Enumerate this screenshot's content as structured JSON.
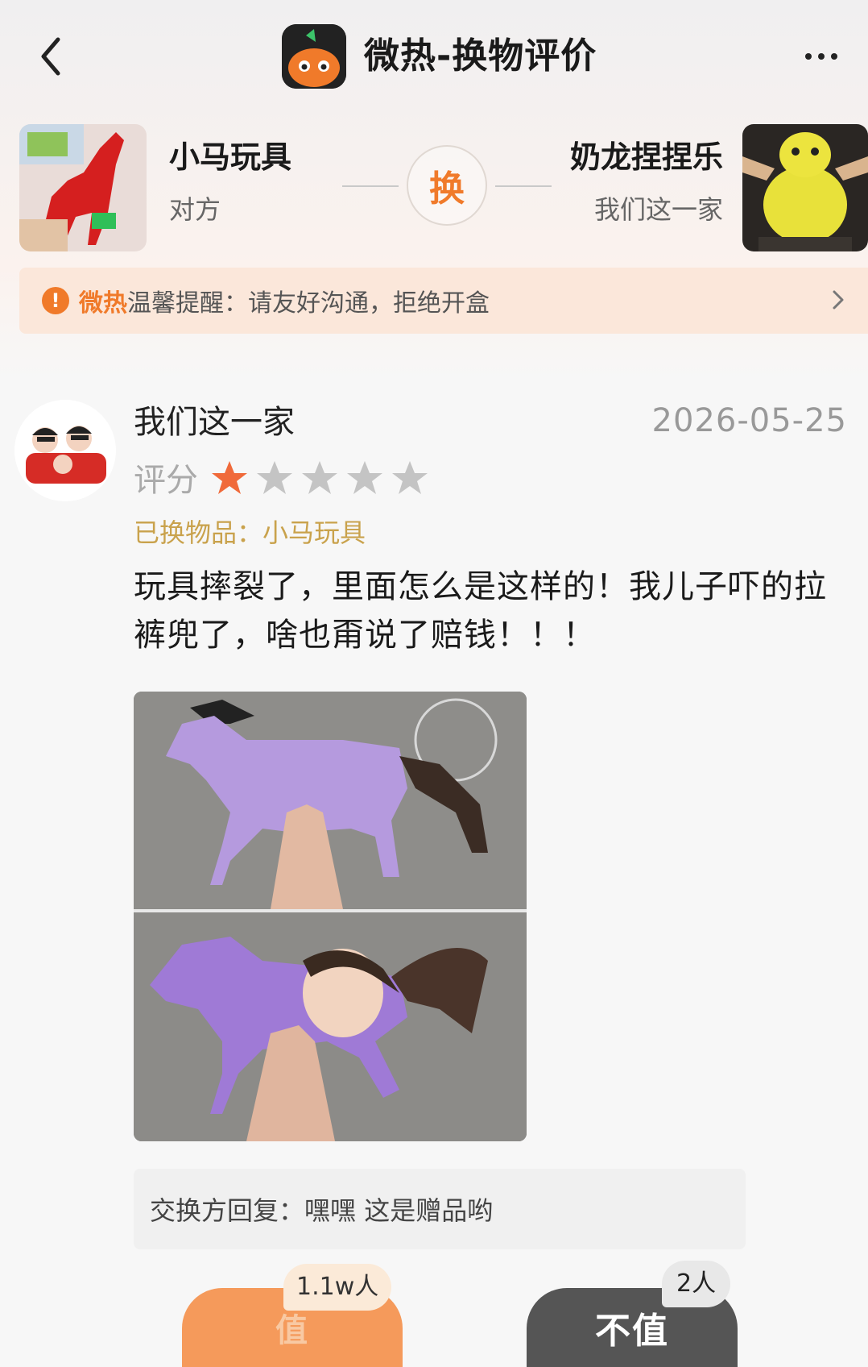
{
  "header": {
    "title": "微热-换物评价"
  },
  "exchange": {
    "left_item_name": "小马玩具",
    "left_item_owner": "对方",
    "swap_label": "换",
    "right_item_name": "奶龙捏捏乐",
    "right_item_owner": "我们这一家"
  },
  "reminder": {
    "brand": "微热",
    "text": "温馨提醒：请友好沟通，拒绝开盒",
    "warning_glyph": "!"
  },
  "review": {
    "reviewer": "我们这一家",
    "date": "2026-05-25",
    "rating_label": "评分",
    "rating": 1,
    "rating_max": 5,
    "item_prefix": "已换物品：",
    "item_name": "小马玩具",
    "text": "玩具摔裂了，里面怎么是这样的！我儿子吓的拉裤兜了，啥也甭说了赔钱！！！"
  },
  "reply": {
    "label": "交换方回复：",
    "text": "嘿嘿 这是赠品哟"
  },
  "votes": {
    "worth_count": "1.1w人",
    "worth_label": "值",
    "notworth_count": "2人",
    "notworth_label": "不值"
  },
  "colors": {
    "accent": "#f07a2a",
    "star_active": "#f06a3a",
    "star_inactive": "#c4c4c4",
    "item_line": "#c9a24c"
  }
}
